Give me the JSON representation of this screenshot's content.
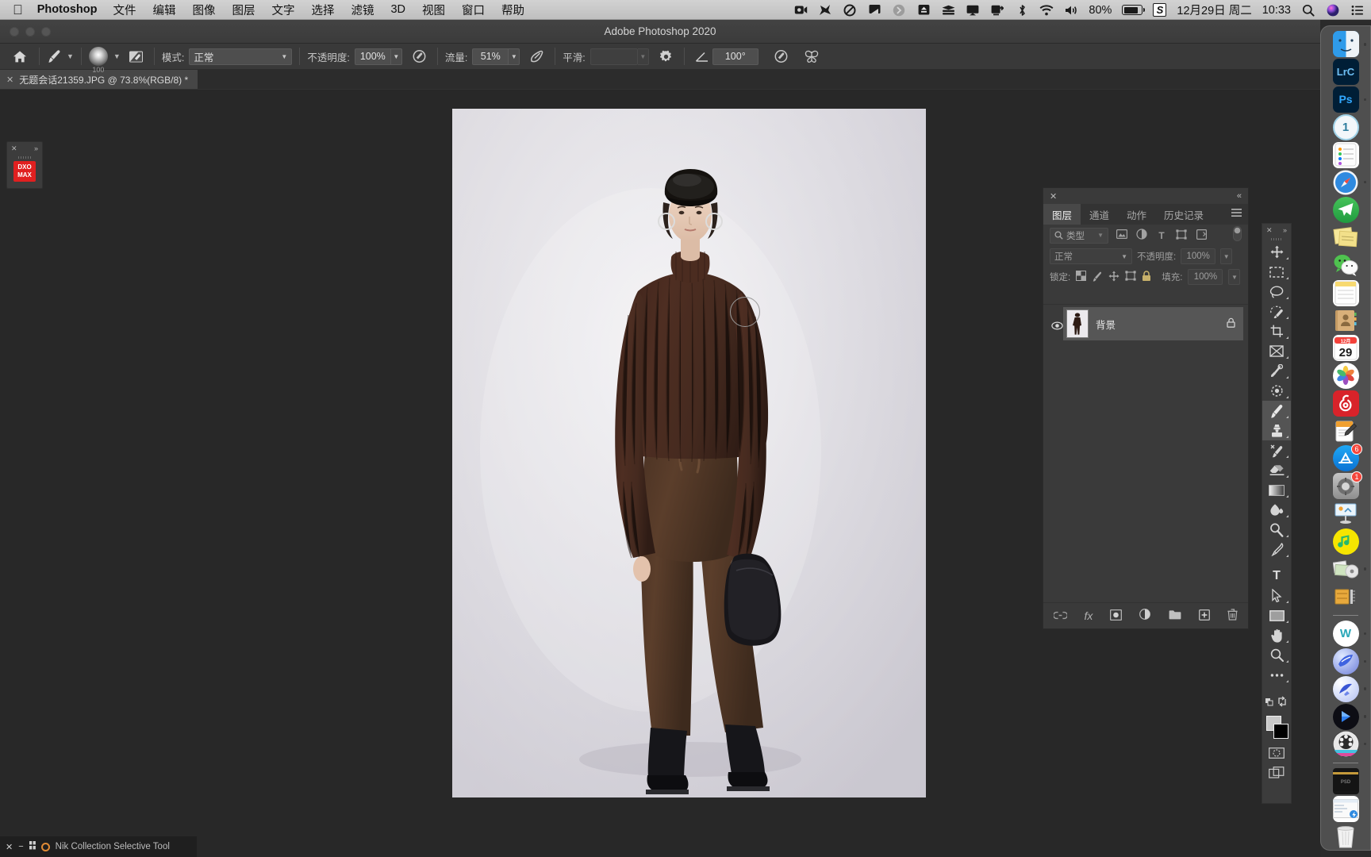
{
  "menubar": {
    "apple": "",
    "app_name": "Photoshop",
    "items": [
      "文件",
      "编辑",
      "图像",
      "图层",
      "文字",
      "选择",
      "滤镜",
      "3D",
      "视图",
      "窗口",
      "帮助"
    ],
    "status_icons": [
      "screen-record-icon",
      "bird-icon",
      "do-not-disturb-icon",
      "display-icon",
      "chevron-right-icon",
      "eject-icon",
      "stack-icon",
      "airplay-icon",
      "screen-share-icon",
      "bluetooth-icon",
      "wifi-icon",
      "volume-icon"
    ],
    "battery_percent": "80%",
    "snip_label": "S",
    "date": "12月29日 周二",
    "time": "10:33",
    "search_icon": "search-icon",
    "siri_icon": "siri-icon",
    "control_center_icon": "control-center-icon"
  },
  "window": {
    "title": "Adobe Photoshop 2020"
  },
  "options_bar": {
    "home_icon": "home-icon",
    "brush_tool_icon": "brush-icon",
    "brush_size": "100",
    "brush_preset_icon": "brush-preset-icon",
    "mode_label": "模式:",
    "mode_value": "正常",
    "opacity_label": "不透明度:",
    "opacity_value": "100%",
    "pressure_opacity_icon": "pressure-opacity-icon",
    "flow_label": "流量:",
    "flow_value": "51%",
    "airbrush_icon": "airbrush-icon",
    "smoothing_label": "平滑:",
    "smoothing_value": "",
    "smoothing_options_icon": "gear-icon",
    "angle_icon": "angle-icon",
    "angle_value": "100°",
    "pressure_size_icon": "pressure-size-icon",
    "symmetry_icon": "symmetry-butterfly-icon"
  },
  "document_tab": {
    "close_icon": "close-icon",
    "title": "无题会话21359.JPG @ 73.8%(RGB/8) *"
  },
  "dxo_panel": {
    "close_icon": "close-icon",
    "expand_icon": "expand-icon",
    "badge_line1": "DXO",
    "badge_line2": "MAX"
  },
  "layers_panel": {
    "close_icon": "close-icon",
    "collapse_icon": "collapse-icon",
    "menu_icon": "panel-menu-icon",
    "tabs": [
      {
        "label": "图层",
        "active": true
      },
      {
        "label": "通道",
        "active": false
      },
      {
        "label": "动作",
        "active": false
      },
      {
        "label": "历史记录",
        "active": false
      }
    ],
    "filter": {
      "search_icon": "search-icon",
      "kind_label": "类型",
      "chevron": "chevron-down-icon",
      "icons": [
        "pixel-filter-icon",
        "adjustment-filter-icon",
        "type-filter-icon",
        "shape-filter-icon",
        "smartobject-filter-icon"
      ],
      "toggle_icon": "filter-toggle-icon"
    },
    "blend": {
      "mode_value": "正常",
      "opacity_label": "不透明度:",
      "opacity_value": "100%"
    },
    "lock": {
      "label": "锁定:",
      "icons": [
        "lock-transparency-icon",
        "lock-image-icon",
        "lock-position-icon",
        "lock-artboard-icon",
        "lock-all-icon"
      ],
      "fill_label": "填充:",
      "fill_value": "100%"
    },
    "layers": [
      {
        "name": "背景",
        "visible": true,
        "locked": true,
        "selected": true
      }
    ],
    "footer_icons": [
      "link-layers-icon",
      "layer-style-fx-icon",
      "add-mask-icon",
      "adjustment-layer-icon",
      "new-group-icon",
      "new-layer-icon",
      "delete-layer-icon"
    ]
  },
  "tools_panel": {
    "close_icon": "close-icon",
    "expand_icon": "expand-icon",
    "tools": [
      {
        "name": "move-tool-icon",
        "glyph": "✥",
        "selected": false
      },
      {
        "name": "marquee-tool-icon",
        "glyph": "▭",
        "selected": false
      },
      {
        "name": "lasso-tool-icon",
        "glyph": "◯",
        "selected": false
      },
      {
        "name": "quick-selection-tool-icon",
        "glyph": "✎",
        "selected": false
      },
      {
        "name": "crop-tool-icon",
        "glyph": "⌗",
        "selected": false
      },
      {
        "name": "frame-tool-icon",
        "glyph": "⊠",
        "selected": false
      },
      {
        "name": "eyedropper-tool-icon",
        "glyph": "⚲",
        "selected": false
      },
      {
        "name": "healing-brush-tool-icon",
        "glyph": "◌",
        "selected": false
      },
      {
        "name": "brush-tool-icon",
        "glyph": "🖌",
        "selected": true
      },
      {
        "name": "clone-stamp-tool-icon",
        "glyph": "♟",
        "selected": true
      },
      {
        "name": "history-brush-tool-icon",
        "glyph": "✒",
        "selected": false
      },
      {
        "name": "eraser-tool-icon",
        "glyph": "▰",
        "selected": false
      },
      {
        "name": "gradient-tool-icon",
        "glyph": "▤",
        "selected": false
      },
      {
        "name": "blur-tool-icon",
        "glyph": "◖",
        "selected": false
      },
      {
        "name": "dodge-tool-icon",
        "glyph": "♤",
        "selected": false
      },
      {
        "name": "pen-tool-icon",
        "glyph": "✑",
        "selected": false
      },
      {
        "name": "type-tool-icon",
        "glyph": "T",
        "selected": false
      },
      {
        "name": "path-selection-tool-icon",
        "glyph": "➤",
        "selected": false
      },
      {
        "name": "rectangle-tool-icon",
        "glyph": "▭",
        "selected": false
      },
      {
        "name": "hand-tool-icon",
        "glyph": "✋",
        "selected": false
      },
      {
        "name": "zoom-tool-icon",
        "glyph": "🔍",
        "selected": false
      },
      {
        "name": "edit-toolbar-icon",
        "glyph": "•••",
        "selected": false
      }
    ],
    "swap_colors_icon": "swap-colors-icon",
    "default_colors_icon": "default-colors-icon",
    "foreground_color": "#c8c8c8",
    "background_color": "#000000",
    "quick_mask_icon": "quick-mask-icon",
    "screen_mode_icon": "screen-mode-icon"
  },
  "dock": {
    "items": [
      {
        "name": "finder",
        "label": "",
        "running": true
      },
      {
        "name": "lightroom-classic",
        "label": "LrC",
        "running": false
      },
      {
        "name": "photoshop",
        "label": "Ps",
        "running": true
      },
      {
        "name": "capture-one",
        "label": "1",
        "running": false
      },
      {
        "name": "reminders",
        "label": "",
        "running": false
      },
      {
        "name": "safari",
        "label": "",
        "running": true
      },
      {
        "name": "telegram",
        "label": "",
        "running": false
      },
      {
        "name": "stickies",
        "label": "",
        "running": false
      },
      {
        "name": "wechat",
        "label": "",
        "running": false
      },
      {
        "name": "notes",
        "label": "",
        "running": false
      },
      {
        "name": "contacts",
        "label": "",
        "running": false
      },
      {
        "name": "calendar",
        "label": "29",
        "running": false
      },
      {
        "name": "photos",
        "label": "",
        "running": false
      },
      {
        "name": "netease-music",
        "label": "",
        "running": false
      },
      {
        "name": "pages",
        "label": "",
        "running": false
      },
      {
        "name": "app-store",
        "label": "",
        "running": false,
        "badge": "6"
      },
      {
        "name": "system-preferences",
        "label": "",
        "running": false,
        "badge": "1"
      },
      {
        "name": "keynote",
        "label": "",
        "running": false
      },
      {
        "name": "qq-music",
        "label": "",
        "running": false
      },
      {
        "name": "image-capture",
        "label": "",
        "running": true
      },
      {
        "name": "file-archiver",
        "label": "",
        "running": false
      },
      {
        "name": "wps-office",
        "label": "W",
        "running": true
      },
      {
        "name": "bird-app",
        "label": "",
        "running": true
      },
      {
        "name": "transfer-app",
        "label": "",
        "running": true
      },
      {
        "name": "video-player",
        "label": "",
        "running": true
      },
      {
        "name": "film-app",
        "label": "",
        "running": true
      },
      {
        "name": "downloads-folder",
        "label": "",
        "running": false
      },
      {
        "name": "recent-documents",
        "label": "",
        "running": false
      },
      {
        "name": "trash",
        "label": "",
        "running": false
      }
    ]
  },
  "status_bar": {
    "close_icon": "close-icon",
    "minimize_icon": "minimize-icon",
    "grid_icon": "grid-icon",
    "plugin_name": "Nik Collection Selective Tool"
  }
}
